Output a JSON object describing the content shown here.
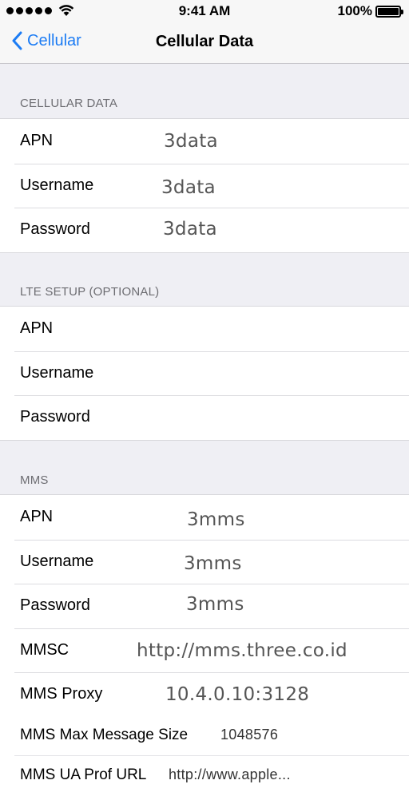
{
  "status_bar": {
    "time": "9:41 AM",
    "battery": "100%",
    "signal_bars": 5,
    "wifi_icon": "wifi-icon",
    "battery_icon": "battery-icon"
  },
  "nav": {
    "back_label": "Cellular",
    "title": "Cellular Data",
    "back_color": "#1c7cf4"
  },
  "sections": {
    "cellular_data": {
      "header": "CELLULAR DATA",
      "rows": [
        {
          "label": "APN",
          "value": "3data"
        },
        {
          "label": "Username",
          "value": "3data"
        },
        {
          "label": "Password",
          "value": "3data"
        }
      ]
    },
    "lte_setup": {
      "header": "LTE SETUP (OPTIONAL)",
      "rows": [
        {
          "label": "APN",
          "value": ""
        },
        {
          "label": "Username",
          "value": ""
        },
        {
          "label": "Password",
          "value": ""
        }
      ]
    },
    "mms": {
      "header": "MMS",
      "rows": [
        {
          "label": "APN",
          "value": "3mms"
        },
        {
          "label": "Username",
          "value": "3mms"
        },
        {
          "label": "Password",
          "value": "3mms"
        },
        {
          "label": "MMSC",
          "value": "http://mms.three.co.id"
        },
        {
          "label": "MMS Proxy",
          "value": "10.4.0.10:3128"
        },
        {
          "label": "MMS Max Message Size",
          "value": "1048576"
        },
        {
          "label": "MMS UA Prof URL",
          "value": "http://www.apple..."
        }
      ]
    }
  }
}
